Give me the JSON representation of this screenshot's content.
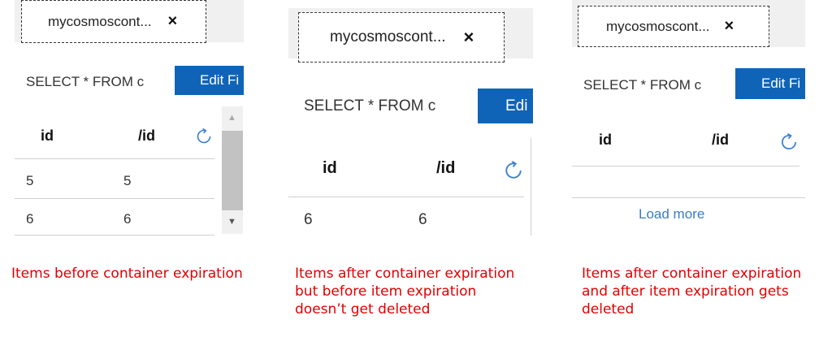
{
  "panel1": {
    "tab_label": "mycosmoscont...",
    "close_glyph": "×",
    "query_text": "SELECT * FROM c",
    "edit_label": "Edit Fi",
    "headers": {
      "id": "id",
      "pk": "/id"
    },
    "rows": [
      {
        "id": "5",
        "pk": "5"
      },
      {
        "id": "6",
        "pk": "6"
      }
    ],
    "scroll_up": "▲",
    "scroll_down": "▼",
    "caption_lines": [
      "Items before container expiration"
    ]
  },
  "panel2": {
    "tab_label": "mycosmoscont...",
    "close_glyph": "×",
    "query_text": "SELECT * FROM c",
    "edit_label": "Edi",
    "headers": {
      "id": "id",
      "pk": "/id"
    },
    "rows": [
      {
        "id": "6",
        "pk": "6"
      }
    ],
    "caption_lines": [
      "Items after container expiration",
      "but before item expiration",
      "doesn’t get deleted"
    ]
  },
  "panel3": {
    "tab_label": "mycosmoscont...",
    "close_glyph": "×",
    "query_text": "SELECT * FROM c",
    "edit_label": "Edit Fi",
    "headers": {
      "id": "id",
      "pk": "/id"
    },
    "load_more_label": "Load more",
    "caption_lines": [
      "Items after container expiration",
      "and after item expiration gets",
      "deleted"
    ]
  },
  "colors": {
    "accent": "#0f64b7",
    "caption": "#e00000",
    "link": "#3b7cc4"
  },
  "icons": [
    "close-icon",
    "refresh-icon",
    "scroll-up-icon",
    "scroll-down-icon"
  ]
}
